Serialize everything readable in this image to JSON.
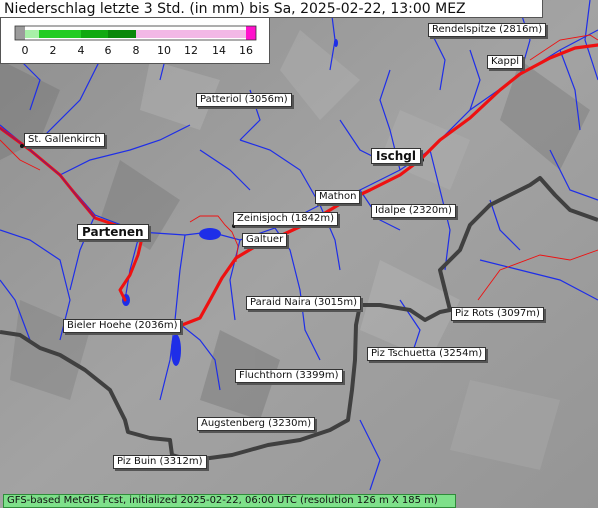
{
  "header": {
    "title": "Niederschlag letzte 3 Std. (in mm) bis Sa, 2025-02-22, 13:00 MEZ"
  },
  "legend": {
    "ticks": [
      "0",
      "2",
      "4",
      "6",
      "8",
      "10",
      "12",
      "14",
      "16"
    ],
    "colors": {
      "c0_1": "#9c9c9c",
      "c1_2": "#a8f0a8",
      "c2_4": "#22cc22",
      "c4_6": "#11aa11",
      "c6_8": "#0a880a",
      "c8_16": "#f2b8e6",
      "c16_plus": "#ff11cc"
    }
  },
  "places": {
    "rendelspitze": "Rendelspitze (2816m)",
    "kappl": "Kappl",
    "patteriol": "Patteriol (3056m)",
    "st_gallenkirch": "St. Gallenkirch",
    "ischgl": "Ischgl",
    "mathon": "Mathon",
    "idalpe": "Idalpe (2320m)",
    "zeinisjoch": "Zeinisjoch (1842m)",
    "partenen": "Partenen",
    "galtuer": "Galtuer",
    "paraid_naira": "Paraid Naira (3015m)",
    "piz_rots": "Piz Rots (3097m)",
    "bieler_hoehe": "Bieler Hoehe (2036m)",
    "piz_tschuetta": "Piz Tschuetta (3254m)",
    "fluchthorn": "Fluchthorn (3399m)",
    "augstenberg": "Augstenberg (3230m)",
    "piz_buin": "Piz Buin (3312m)"
  },
  "footer": {
    "text": "GFS-based MetGIS Fcst, initialized 2025-02-22, 06:00 UTC  (resolution 126 m X 185 m)"
  },
  "colors": {
    "terrain": "#9a9a9a",
    "rivers": "#1e2ee8",
    "roads": "#ee1111",
    "border": "#404040",
    "footer_bg": "#7ee08a"
  }
}
